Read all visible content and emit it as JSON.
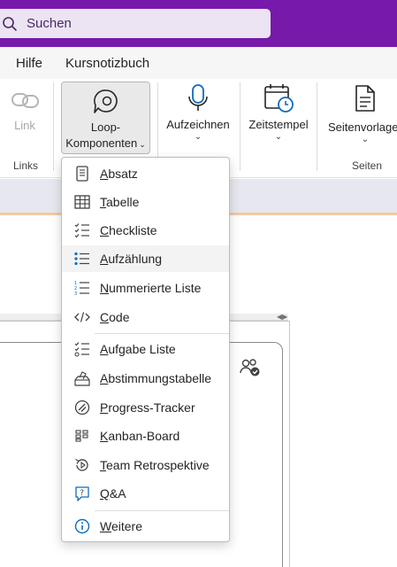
{
  "search": {
    "placeholder": "Suchen"
  },
  "menu": [
    {
      "label": "Hilfe"
    },
    {
      "label": "Kursnotizbuch"
    }
  ],
  "ribbon": {
    "link": {
      "label": "Link"
    },
    "loop": {
      "label_line1": "Loop-",
      "label_line2": "Komponenten"
    },
    "aufzeichnen": {
      "label": "Aufzeichnen"
    },
    "zeitstempel": {
      "label": "Zeitstempel"
    },
    "seitenvorlagen": {
      "label": "Seitenvorlage"
    },
    "groups": {
      "links": "Links",
      "seiten": "Seiten"
    }
  },
  "dropdown": {
    "items": [
      {
        "key": "A",
        "rest": "bsatz",
        "icon": "paragraph-icon"
      },
      {
        "key": "T",
        "rest": "abelle",
        "icon": "table-icon"
      },
      {
        "key": "C",
        "rest": "heckliste",
        "icon": "checklist-icon"
      },
      {
        "key": "A",
        "rest": "ufzählung",
        "icon": "bullet-list-icon"
      },
      {
        "key": "N",
        "rest": "ummerierte Liste",
        "icon": "numbered-list-icon"
      },
      {
        "key": "C",
        "rest": "ode",
        "icon": "code-icon"
      },
      {
        "key": "A",
        "rest": "ufgabe Liste",
        "icon": "task-list-icon"
      },
      {
        "key": "A",
        "rest": "bstimmungstabelle",
        "icon": "voting-table-icon"
      },
      {
        "key": "P",
        "rest": "rogress-Tracker",
        "icon": "progress-tracker-icon"
      },
      {
        "key": "K",
        "rest": "anban-Board",
        "icon": "kanban-board-icon"
      },
      {
        "key": "T",
        "rest": "eam Retrospektive",
        "icon": "team-retrospective-icon"
      },
      {
        "key": "Q",
        "rest": "&A",
        "icon": "qa-icon"
      },
      {
        "key": "W",
        "rest": "eitere",
        "icon": "info-icon"
      }
    ]
  },
  "colors": {
    "brand": "#7719aa",
    "accent": "#0f6cbd",
    "hover": "#f3f3f3"
  }
}
